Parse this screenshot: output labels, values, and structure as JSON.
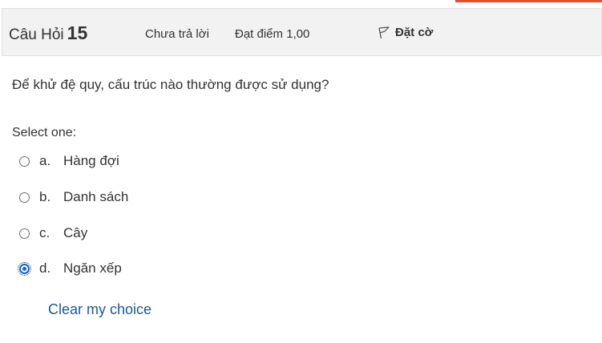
{
  "header": {
    "question_prefix": "Câu Hỏi",
    "question_number": "15",
    "state": "Chưa trả lời",
    "grade": "Đạt điểm 1,00",
    "flag_label": "Đặt cờ",
    "flag_icon": "flag-outline-icon"
  },
  "question": {
    "text": "Để khử đệ quy, cấu trúc nào thường được sử dụng?",
    "prompt": "Select one:",
    "answers": [
      {
        "letter": "a.",
        "text": "Hàng đợi",
        "checked": false
      },
      {
        "letter": "b.",
        "text": "Danh sách",
        "checked": false
      },
      {
        "letter": "c.",
        "text": "Cây",
        "checked": false
      },
      {
        "letter": "d.",
        "text": "Ngăn xếp",
        "checked": true
      }
    ],
    "clear_label": "Clear my choice"
  },
  "colors": {
    "accent_strip": "#e3502a",
    "link": "#1a5a96",
    "radio_selected": "#0b64d8",
    "header_bg": "#f2f2f2"
  }
}
